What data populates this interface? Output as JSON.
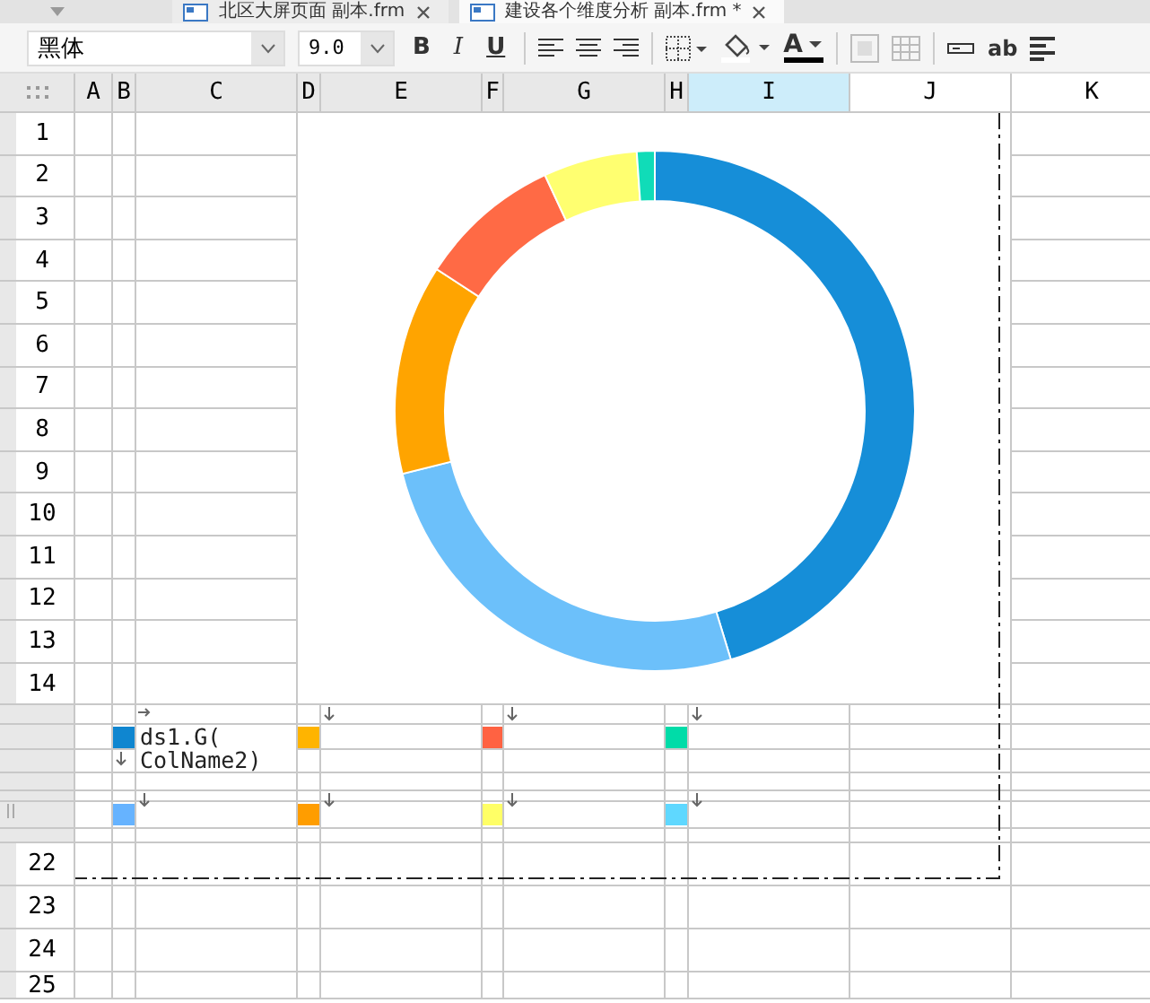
{
  "tabs": [
    {
      "title": "北区大屏页面 副本.frm",
      "selected": false
    },
    {
      "title": "建设各个维度分析 副本.frm *",
      "selected": true
    }
  ],
  "toolbar": {
    "font": "黑体",
    "size": "9.0",
    "bold": "B",
    "italic": "I",
    "underline": "U",
    "font_color": "A",
    "wrap_text": "ab"
  },
  "columns": [
    {
      "label": "A",
      "selected": false,
      "shaded": true
    },
    {
      "label": "B",
      "selected": false,
      "shaded": true
    },
    {
      "label": "C",
      "selected": false,
      "shaded": true
    },
    {
      "label": "D",
      "selected": false,
      "shaded": true
    },
    {
      "label": "E",
      "selected": false,
      "shaded": true
    },
    {
      "label": "F",
      "selected": false,
      "shaded": true
    },
    {
      "label": "G",
      "selected": false,
      "shaded": true
    },
    {
      "label": "H",
      "selected": false,
      "shaded": true
    },
    {
      "label": "I",
      "selected": true,
      "shaded": true
    },
    {
      "label": "J",
      "selected": false,
      "shaded": false
    },
    {
      "label": "K",
      "selected": false,
      "shaded": false
    }
  ],
  "rows": [
    {
      "label": "1"
    },
    {
      "label": "2"
    },
    {
      "label": "3"
    },
    {
      "label": "4"
    },
    {
      "label": "5"
    },
    {
      "label": "6"
    },
    {
      "label": "7"
    },
    {
      "label": "8"
    },
    {
      "label": "9"
    },
    {
      "label": "10"
    },
    {
      "label": "11"
    },
    {
      "label": "12"
    },
    {
      "label": "13"
    },
    {
      "label": "14"
    },
    {
      "kind": "sub"
    },
    {
      "kind": "sub"
    },
    {
      "kind": "sub"
    },
    {
      "kind": "sub"
    },
    {
      "kind": "sub"
    },
    {
      "kind": "sub"
    },
    {
      "kind": "sub"
    },
    {
      "label": "22"
    },
    {
      "label": "23"
    },
    {
      "label": "24"
    },
    {
      "label": "25"
    }
  ],
  "series_cells": [
    {
      "cells": [
        {
          "color": "#0f86d0",
          "text": "ds1.G(\nColName2)"
        },
        {
          "color": "#ffb400"
        },
        {
          "color": "#ff6242"
        },
        {
          "color": "#00dca8"
        }
      ]
    },
    {
      "cells": [
        {
          "color": "#66b3ff"
        },
        {
          "color": "#ff9d00"
        },
        {
          "color": "#ffff66"
        },
        {
          "color": "#5fd8ff"
        }
      ]
    }
  ]
}
